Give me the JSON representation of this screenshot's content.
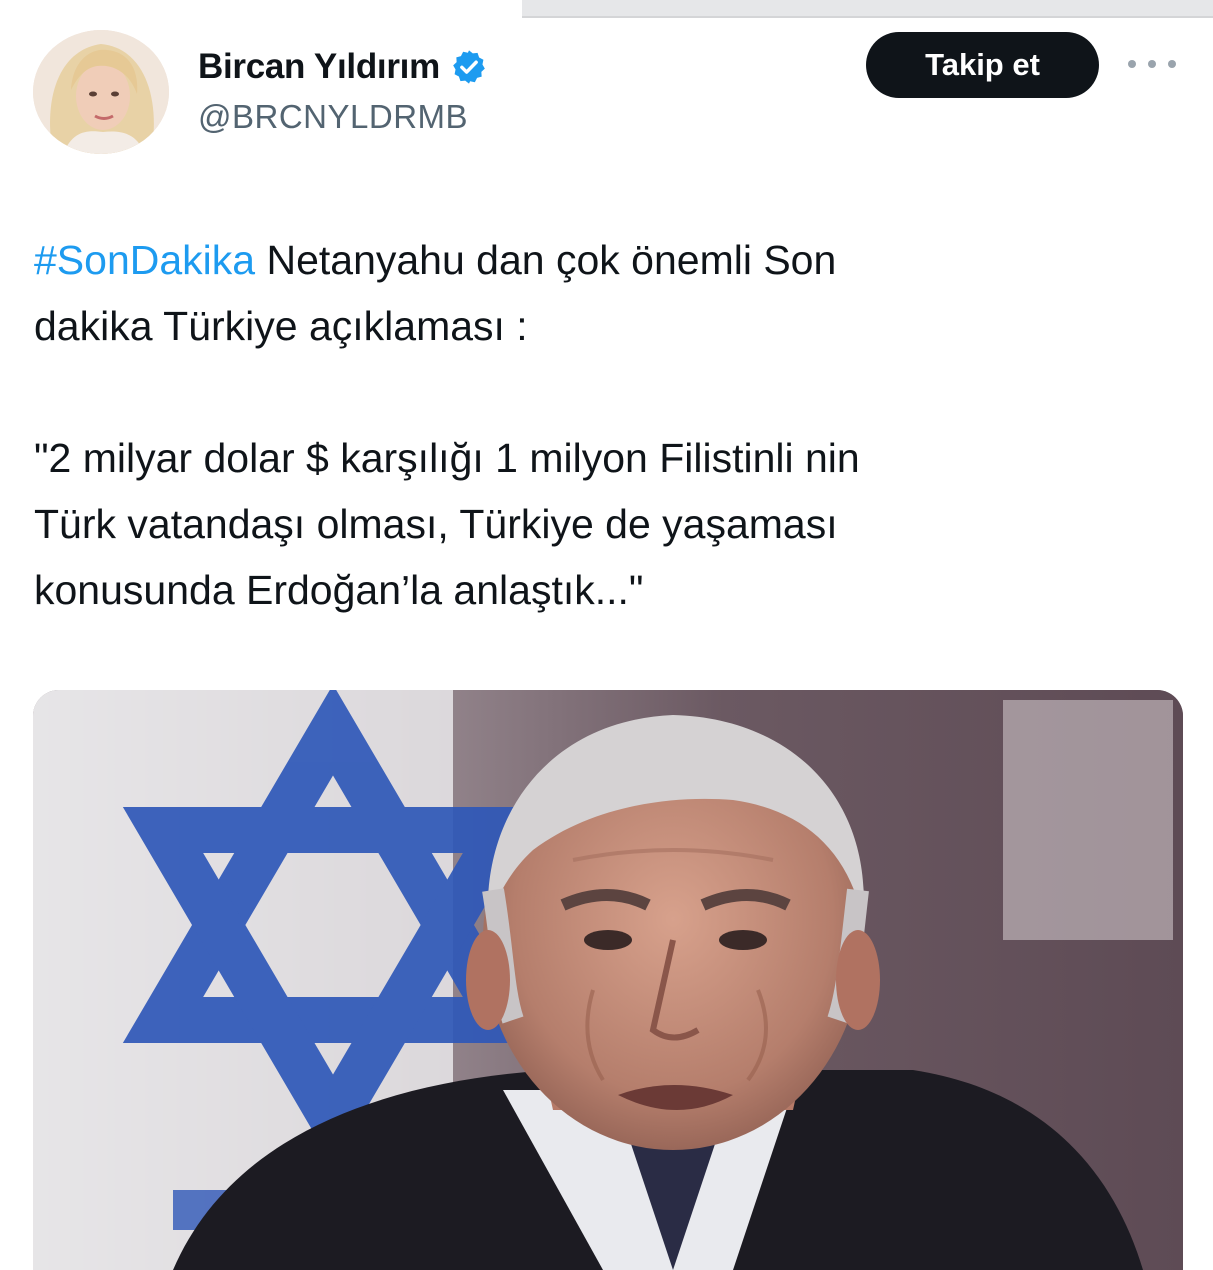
{
  "tweet": {
    "author": {
      "display_name": "Bircan Yıldırım",
      "handle": "@BRCNYLDRMB",
      "verified": true
    },
    "follow_label": "Takip et",
    "text": {
      "hashtag": "#SonDakika",
      "line1_rest": " Netanyahu dan çok önemli Son",
      "line2": "dakika Türkiye açıklaması :",
      "quote_line1": "\"2 milyar dolar $ karşılığı 1 milyon Filistinli nin",
      "quote_line2": "Türk vatandaşı olması, Türkiye de yaşaması",
      "quote_line3": "konusunda Erdoğan’la anlaştık...\""
    }
  },
  "colors": {
    "link": "#1d9bf0",
    "button_bg": "#0f1419",
    "secondary_text": "#536471",
    "verified_badge": "#1d9bf0"
  }
}
